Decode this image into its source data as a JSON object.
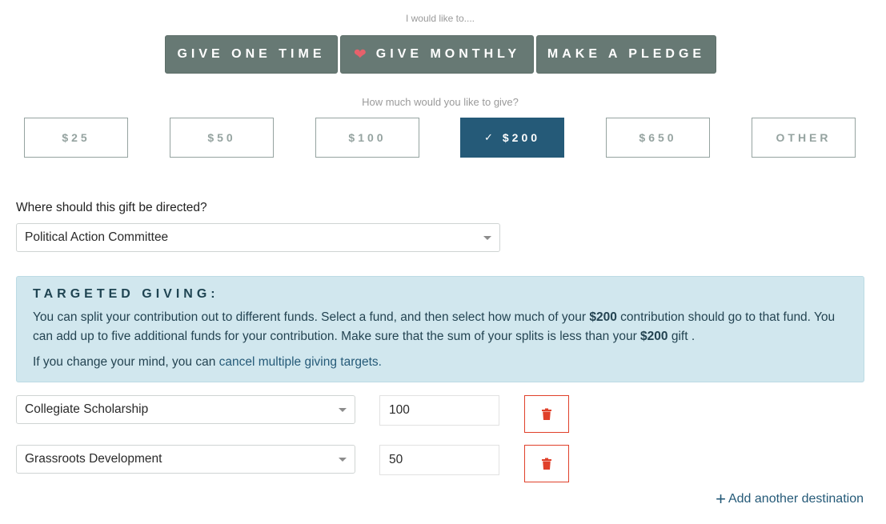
{
  "give_type": {
    "prompt": "I would like to....",
    "options": [
      {
        "label": "GIVE ONE TIME",
        "icon": null
      },
      {
        "label": "GIVE MONTHLY",
        "icon": "heart-icon"
      },
      {
        "label": "MAKE A PLEDGE",
        "icon": null
      }
    ],
    "colors": {
      "button_bg": "#677974",
      "heart": "#e7616b"
    }
  },
  "amount": {
    "prompt": "How much would you like to give?",
    "options": [
      {
        "label": "$25",
        "selected": false
      },
      {
        "label": "$50",
        "selected": false
      },
      {
        "label": "$100",
        "selected": false
      },
      {
        "label": "$200",
        "selected": true
      },
      {
        "label": "$650",
        "selected": false
      },
      {
        "label": "OTHER",
        "selected": false
      }
    ],
    "selected_icon": "check-icon",
    "colors": {
      "selected_bg": "#255a78",
      "outline": "#95a3a0"
    }
  },
  "direction": {
    "label": "Where should this gift be directed?",
    "selected": "Political Action Committee"
  },
  "targeted_giving": {
    "heading": "TARGETED GIVING:",
    "para1_a": "You can split your contribution out to different funds. Select a fund, and then select how much of your ",
    "amount_bold": "$200",
    "para1_b": " contribution should go to that fund. You can add up to five additional funds for your contribution. Make sure that the sum of your splits is less than your ",
    "para1_c": " gift .",
    "para2_a": "If you change your mind, you can ",
    "para2_link": "cancel multiple giving targets.",
    "colors": {
      "bg": "#d1e7ee",
      "link": "#255a78"
    }
  },
  "splits": [
    {
      "fund": "Collegiate Scholarship",
      "amount": "100"
    },
    {
      "fund": "Grassroots Development",
      "amount": "50"
    }
  ],
  "delete_icon": "trash-icon",
  "add_destination": {
    "icon": "plus-icon",
    "label": "Add another destination"
  }
}
